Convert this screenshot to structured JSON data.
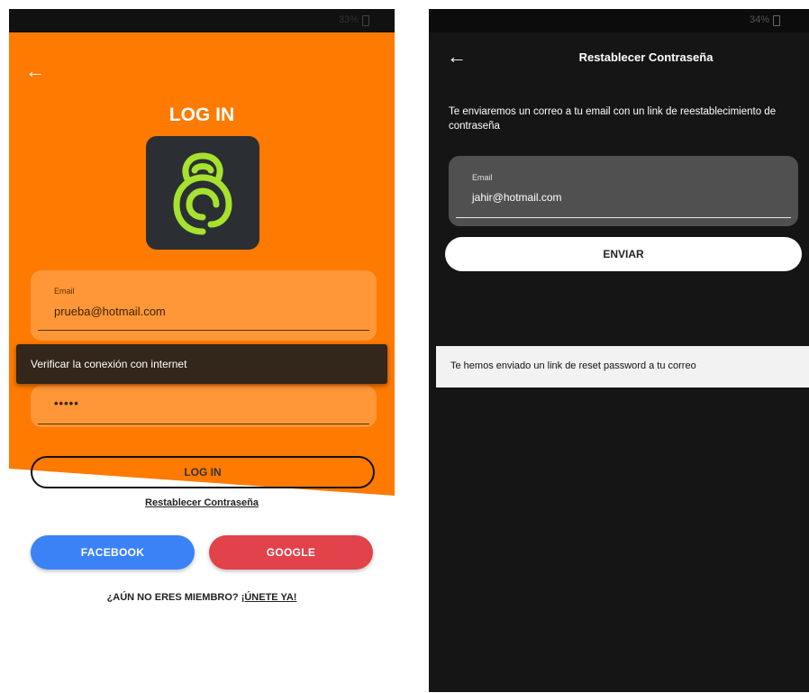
{
  "left_screen": {
    "status": {
      "battery": "33%"
    },
    "title": "LOG IN",
    "email_field": {
      "label": "Email",
      "value": "prueba@hotmail.com"
    },
    "password_field": {
      "value": "•••••"
    },
    "snackbar": "Verificar la conexión con internet",
    "login_button": "LOG IN",
    "reset_link": "Restablecer Contraseña",
    "facebook_button": "FACEBOOK",
    "google_button": "GOOGLE",
    "member_prompt": "¿AÚN NO ERES MIEMBRO?",
    "join_link": "¡ÚNETE YA!",
    "colors": {
      "background": "#ff7a00",
      "logo_box": "#2b2f33",
      "logo_icon": "#a6e22e",
      "facebook": "#3b82f6",
      "google": "#e2424a"
    },
    "icons": [
      "back-arrow-icon",
      "app-logo",
      "battery-icon"
    ]
  },
  "right_screen": {
    "status": {
      "battery": "34%"
    },
    "header_title": "Restablecer Contraseña",
    "info_text": "Te enviaremos un correo a tu email con un link de reestablecimiento de contraseña",
    "email_field": {
      "label": "Email",
      "value": "jahir@hotmail.com"
    },
    "send_button": "ENVIAR",
    "toast": "Te hemos enviado un link de reset password a tu correo",
    "colors": {
      "background": "#151515",
      "field": "#505050"
    },
    "icons": [
      "back-arrow-icon",
      "battery-icon"
    ]
  }
}
